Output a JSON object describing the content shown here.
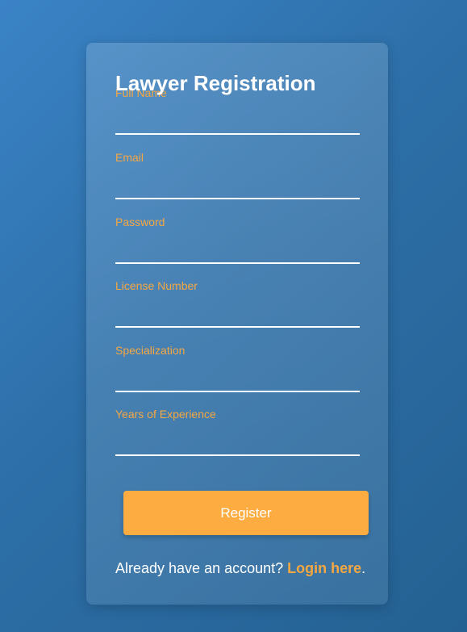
{
  "form": {
    "title": "Lawyer Registration",
    "fields": [
      {
        "label": "Full Name",
        "value": ""
      },
      {
        "label": "Email",
        "value": ""
      },
      {
        "label": "Password",
        "value": ""
      },
      {
        "label": "License Number",
        "value": ""
      },
      {
        "label": "Specialization",
        "value": ""
      },
      {
        "label": "Years of Experience",
        "value": ""
      }
    ],
    "register_label": "Register",
    "footer_prefix": "Already have an account? ",
    "login_link": "Login here",
    "footer_suffix": "."
  },
  "colors": {
    "accent": "#fdac42",
    "label": "#f5a742",
    "text": "#ffffff",
    "background": "#2d6fa8"
  }
}
